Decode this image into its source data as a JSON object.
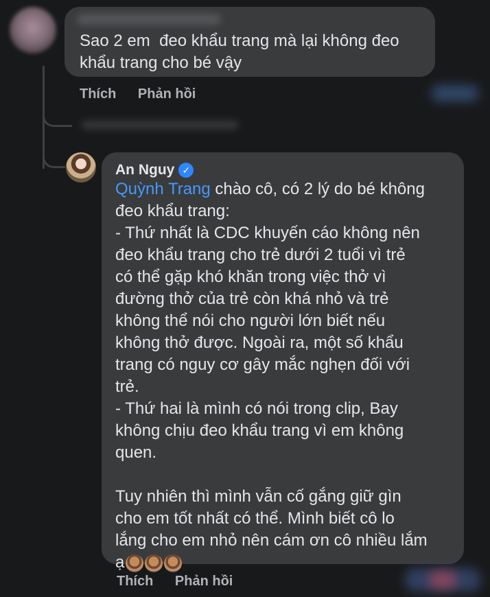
{
  "comment": {
    "text": "Sao 2 em  đeo khẩu trang mà lại không đeo\nkhẩu trang cho bé vậy",
    "actions": {
      "like": "Thích",
      "reply": "Phản hồi"
    }
  },
  "reply": {
    "author": "An Nguy",
    "mention": "Quỳnh Trang",
    "text_after_mention": " chào cô, có 2 lý do bé không\nđeo khẩu trang:\n- Thứ nhất là CDC khuyến cáo không nên\nđeo khẩu trang cho trẻ dưới 2 tuổi vì trẻ\ncó thể gặp khó khăn trong việc thở vì\nđường thở của trẻ còn khá nhỏ và trẻ\nkhông thể nói cho người lớn biết nếu\nkhông thở được. Ngoài ra, một số khẩu\ntrang có nguy cơ gây mắc nghẹn đối với\ntrẻ.\n- Thứ hai là mình có nói trong clip, Bay\nkhông chịu đeo khẩu trang vì em không\nquen.\n\nTuy nhiên thì mình vẫn cố gắng giữ gìn\ncho em tốt nhất có thể. Mình biết cô lo\nlắng cho em nhỏ nên cám ơn cô nhiều lắm\nạ",
    "emojis": [
      "person-gesturing-ok-emoji",
      "person-gesturing-ok-emoji",
      "person-gesturing-ok-emoji"
    ],
    "actions": {
      "like": "Thích",
      "reply": "Phản hồi"
    }
  },
  "colors": {
    "background": "#18191a",
    "bubble": "#3a3b3c",
    "mention": "#4599ff",
    "verified": "#2d88ff"
  }
}
